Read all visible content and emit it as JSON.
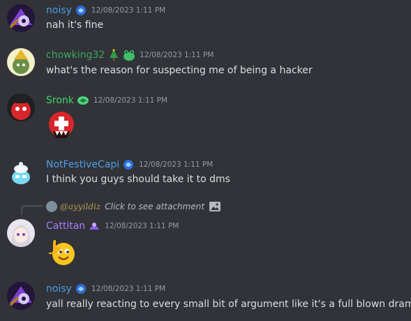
{
  "colors": {
    "background": "#313338",
    "text": "#dbdee1",
    "timestamp": "#949ba4",
    "name_blue": "#4d9de8",
    "name_green": "#3ba55d",
    "name_bright_green": "#43d36b",
    "name_purple": "#a87bff",
    "reply_name": "#b89a52"
  },
  "messages": [
    {
      "username": "noisy",
      "timestamp": "12/08/2023 1:11 PM",
      "text": "nah it's fine",
      "badge_icon": "blue-badge-icon"
    },
    {
      "username": "chowking32",
      "timestamp": "12/08/2023 1:11 PM",
      "text": "what's the reason for suspecting me of being a hacker",
      "badge_icons": [
        "christmas-tree-icon",
        "frog-icon"
      ]
    },
    {
      "username": "Sronk",
      "timestamp": "12/08/2023 1:11 PM",
      "emoji": "swiss-ball-emoji",
      "badge_icon": "green-badge-icon"
    },
    {
      "username": "NotFestiveCapi",
      "timestamp": "12/08/2023 1:11 PM",
      "text": "I think you guys should take it to dms",
      "badge_icon": "blue-badge-icon"
    },
    {
      "username": "Cattitan",
      "timestamp": "12/08/2023 1:11 PM",
      "emoji": "thumbs-up-emoji",
      "badge_icon": "purple-badge-icon",
      "reply": {
        "name": "@ayyildiz",
        "text": "Click to see attachment",
        "icon": "image-icon"
      }
    },
    {
      "username": "noisy",
      "timestamp": "12/08/2023 1:11 PM",
      "text": "yall really reacting to every small bit of argument like it's a full blown drama",
      "badge_icon": "blue-badge-icon"
    }
  ]
}
